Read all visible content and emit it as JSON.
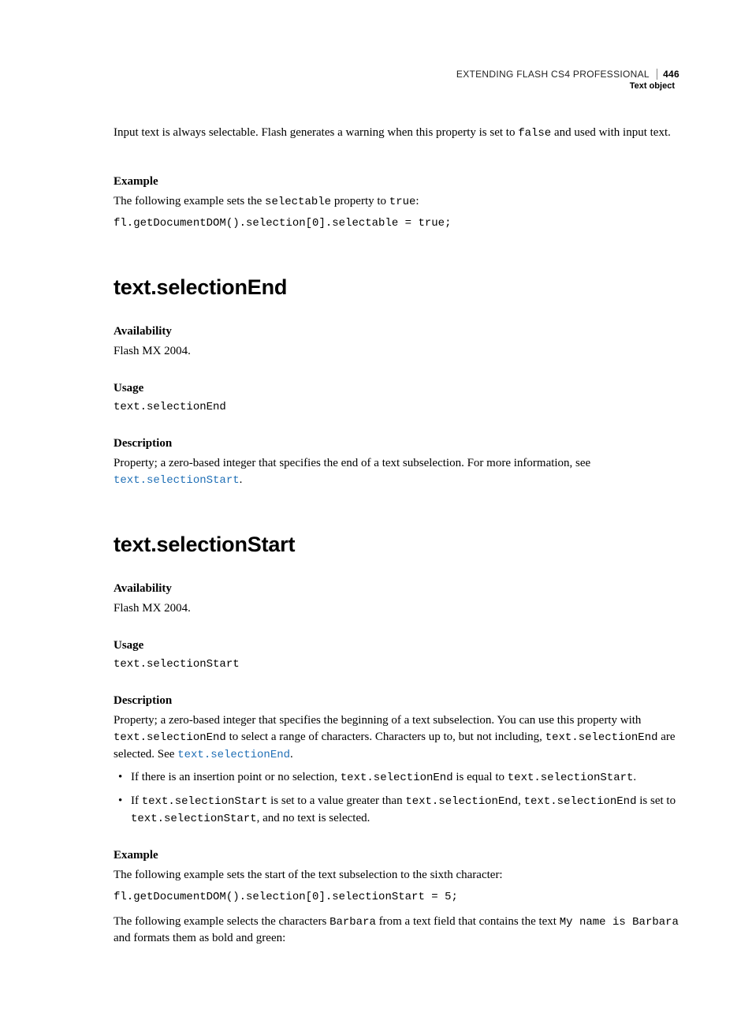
{
  "header": {
    "doc_title": "EXTENDING FLASH CS4 PROFESSIONAL",
    "page_number": "446",
    "section": "Text object"
  },
  "intro": {
    "text_before_code": "Input text is always selectable. Flash generates a warning when this property is set to ",
    "code": "false",
    "text_after_code": " and used with input text."
  },
  "example1": {
    "heading": "Example",
    "sentence_before_code1": "The following example sets the ",
    "code1": "selectable",
    "sentence_mid": " property to ",
    "code2": "true",
    "sentence_after": ":",
    "codeblock": "fl.getDocumentDOM().selection[0].selectable = true;"
  },
  "sec1": {
    "title": "text.selectionEnd",
    "avail_h": "Availability",
    "avail_t": "Flash MX 2004.",
    "usage_h": "Usage",
    "usage_code": "text.selectionEnd",
    "desc_h": "Description",
    "desc_t": "Property; a zero-based integer that specifies the end of a text subselection. For more information, see ",
    "desc_link": "text.selectionStart",
    "desc_after": "."
  },
  "sec2": {
    "title": "text.selectionStart",
    "avail_h": "Availability",
    "avail_t": "Flash MX 2004.",
    "usage_h": "Usage",
    "usage_code": "text.selectionStart",
    "desc_h": "Description",
    "desc_p1_a": "Property; a zero-based integer that specifies the beginning of a text subselection. You can use this property with ",
    "desc_p1_code1": "text.selectionEnd",
    "desc_p1_b": " to select a range of characters. Characters up to, but not including, ",
    "desc_p1_code2": "text.selectionEnd",
    "desc_p1_c": " are selected. See ",
    "desc_p1_link": "text.selectionEnd",
    "desc_p1_d": ".",
    "bullet1_a": "If there is an insertion point or no selection, ",
    "bullet1_code1": "text.selectionEnd",
    "bullet1_b": " is equal to ",
    "bullet1_code2": "text.selectionStart",
    "bullet1_c": ".",
    "bullet2_a": "If ",
    "bullet2_code1": "text.selectionStart",
    "bullet2_b": " is set to a value greater than ",
    "bullet2_code2": "text.selectionEnd",
    "bullet2_c": ", ",
    "bullet2_code3": "text.selectionEnd",
    "bullet2_d": " is set to ",
    "bullet2_code4": "text.selectionStart",
    "bullet2_e": ", and no text is selected.",
    "ex_h": "Example",
    "ex_p1": "The following example sets the start of the text subselection to the sixth character:",
    "ex_code1": "fl.getDocumentDOM().selection[0].selectionStart = 5;",
    "ex_p2_a": "The following example selects the characters ",
    "ex_p2_code1": "Barbara",
    "ex_p2_b": " from a text field that contains the text ",
    "ex_p2_code2": "My name is Barbara",
    "ex_p2_c": " and formats them as bold and green:"
  }
}
